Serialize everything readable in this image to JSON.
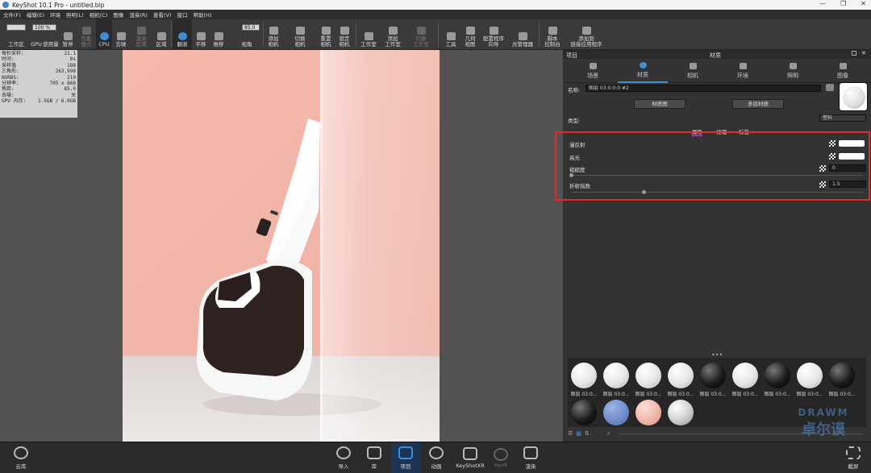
{
  "window": {
    "title": "KeyShot 10.1 Pro  - untitled.bip",
    "minimize": "—",
    "maximize": "❐",
    "close": "✕"
  },
  "menu": [
    "文件(F)",
    "编辑(E)",
    "环境",
    "照明(L)",
    "相机(C)",
    "图像",
    "渲染(R)",
    "查看(V)",
    "窗口",
    "帮助(H)"
  ],
  "toolbar": {
    "workspace_label": "工作区",
    "zoom_value": "100 %",
    "gpu_label": "GPU",
    "usage_label": "使用量",
    "pause": "暂停",
    "perf_mode": "性能\n模式",
    "cpu": "CPU",
    "denoise": "去噪",
    "render_region": "渲染\n区域",
    "region": "区域",
    "tumble": "翻滚",
    "pan": "平移",
    "dolly": "推移",
    "fov_value": "85.0",
    "fov_label": "视角",
    "add_camera": "添加\n相机",
    "switch_camera": "切换\n相机",
    "reset_camera": "重置\n相机",
    "lock_camera": "锁定\n相机",
    "studio": "工作室",
    "add_studio": "添加\n工作室",
    "switch_studio": "切换\n工作室",
    "tools": "工具",
    "geometry_view": "几何\n视图",
    "config_wizard": "配置程序\n向导",
    "light_manager": "光管理器",
    "script_console": "脚本\n控制台",
    "add_to_app": "添加到\n链接应用程序"
  },
  "stats": [
    [
      "每秒采样:",
      "21.1"
    ],
    [
      "时间:",
      "0s"
    ],
    [
      "采样值",
      "188"
    ],
    [
      "三角形:",
      "263,998"
    ],
    [
      "NURBS:",
      "219"
    ],
    [
      "分辨率:",
      "705 x 868"
    ],
    [
      "焦距:",
      "85.0"
    ],
    [
      "去噪:",
      "关"
    ],
    [
      "GPU 内存:",
      "1.5GB / 6.0GB"
    ]
  ],
  "panel": {
    "left_title": "项目",
    "title": "材质",
    "tabs": [
      "场景",
      "材质",
      "相机",
      "环境",
      "照明",
      "图像"
    ],
    "name_label": "名称:",
    "name_value": "图层 03:0:0:0 #2",
    "material_graph": "材质图",
    "multi_material": "多层材质",
    "type_label": "类型:",
    "type_value": "塑料",
    "subtabs": [
      "属性",
      "纹理",
      "标签"
    ],
    "props": [
      {
        "label": "漫反射",
        "kind": "color"
      },
      {
        "label": "高光",
        "kind": "color"
      },
      {
        "label": "粗糙度",
        "value": "0",
        "slider": 0.0
      },
      {
        "label": "折射指数",
        "value": "1.5",
        "slider": 0.25
      }
    ],
    "materials": [
      {
        "label": "图层 03:0...",
        "color": "white"
      },
      {
        "label": "图层 03:0...",
        "color": "white"
      },
      {
        "label": "图层 03:0...",
        "color": "white"
      },
      {
        "label": "图层 03:0...",
        "color": "white"
      },
      {
        "label": "图层 03:0...",
        "color": "black"
      },
      {
        "label": "图层 03:0...",
        "color": "white"
      },
      {
        "label": "图层 03:0...",
        "color": "black"
      },
      {
        "label": "图层 03:0...",
        "color": "white"
      },
      {
        "label": "图层 03:0...",
        "color": "black"
      },
      {
        "label": "",
        "color": "black"
      },
      {
        "label": "",
        "color": "blue"
      },
      {
        "label": "",
        "color": "pink"
      },
      {
        "label": "",
        "color": "clear"
      }
    ]
  },
  "bottom": {
    "cloud": "云库",
    "import": "导入",
    "library": "库",
    "project": "项目",
    "animation": "动画",
    "keyshotxr": "KeyShotXR",
    "render_dim": "KeyVR",
    "render": "渲染",
    "screenshot": "截屏"
  },
  "watermark": {
    "line1": "DRAWM",
    "line2": "卓尔谟"
  }
}
